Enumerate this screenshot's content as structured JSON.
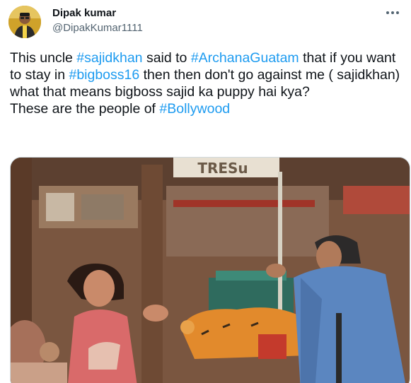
{
  "user": {
    "display_name": "Dipak kumar",
    "handle": "@DipakKumar1111",
    "avatar_icon": "user-avatar"
  },
  "more_icon": "more-horizontal-icon",
  "tweet": {
    "segments": [
      {
        "text": "This uncle ",
        "type": "text"
      },
      {
        "text": "#sajidkhan",
        "type": "hashtag"
      },
      {
        "text": " said to ",
        "type": "text"
      },
      {
        "text": "#ArchanaGuatam",
        "type": "hashtag"
      },
      {
        "text": " that if you want to stay in ",
        "type": "text"
      },
      {
        "text": "#bigboss16",
        "type": "hashtag"
      },
      {
        "text": " then then don't go against me ( sajidkhan) what that means bigboss sajid ka puppy hai kya?\nThese are the people of ",
        "type": "text"
      },
      {
        "text": "#Bollywood",
        "type": "hashtag"
      }
    ]
  },
  "media": {
    "sign_text": "TRESu"
  },
  "colors": {
    "link": "#1d9bf0",
    "text": "#0f1419",
    "secondary": "#536471"
  }
}
